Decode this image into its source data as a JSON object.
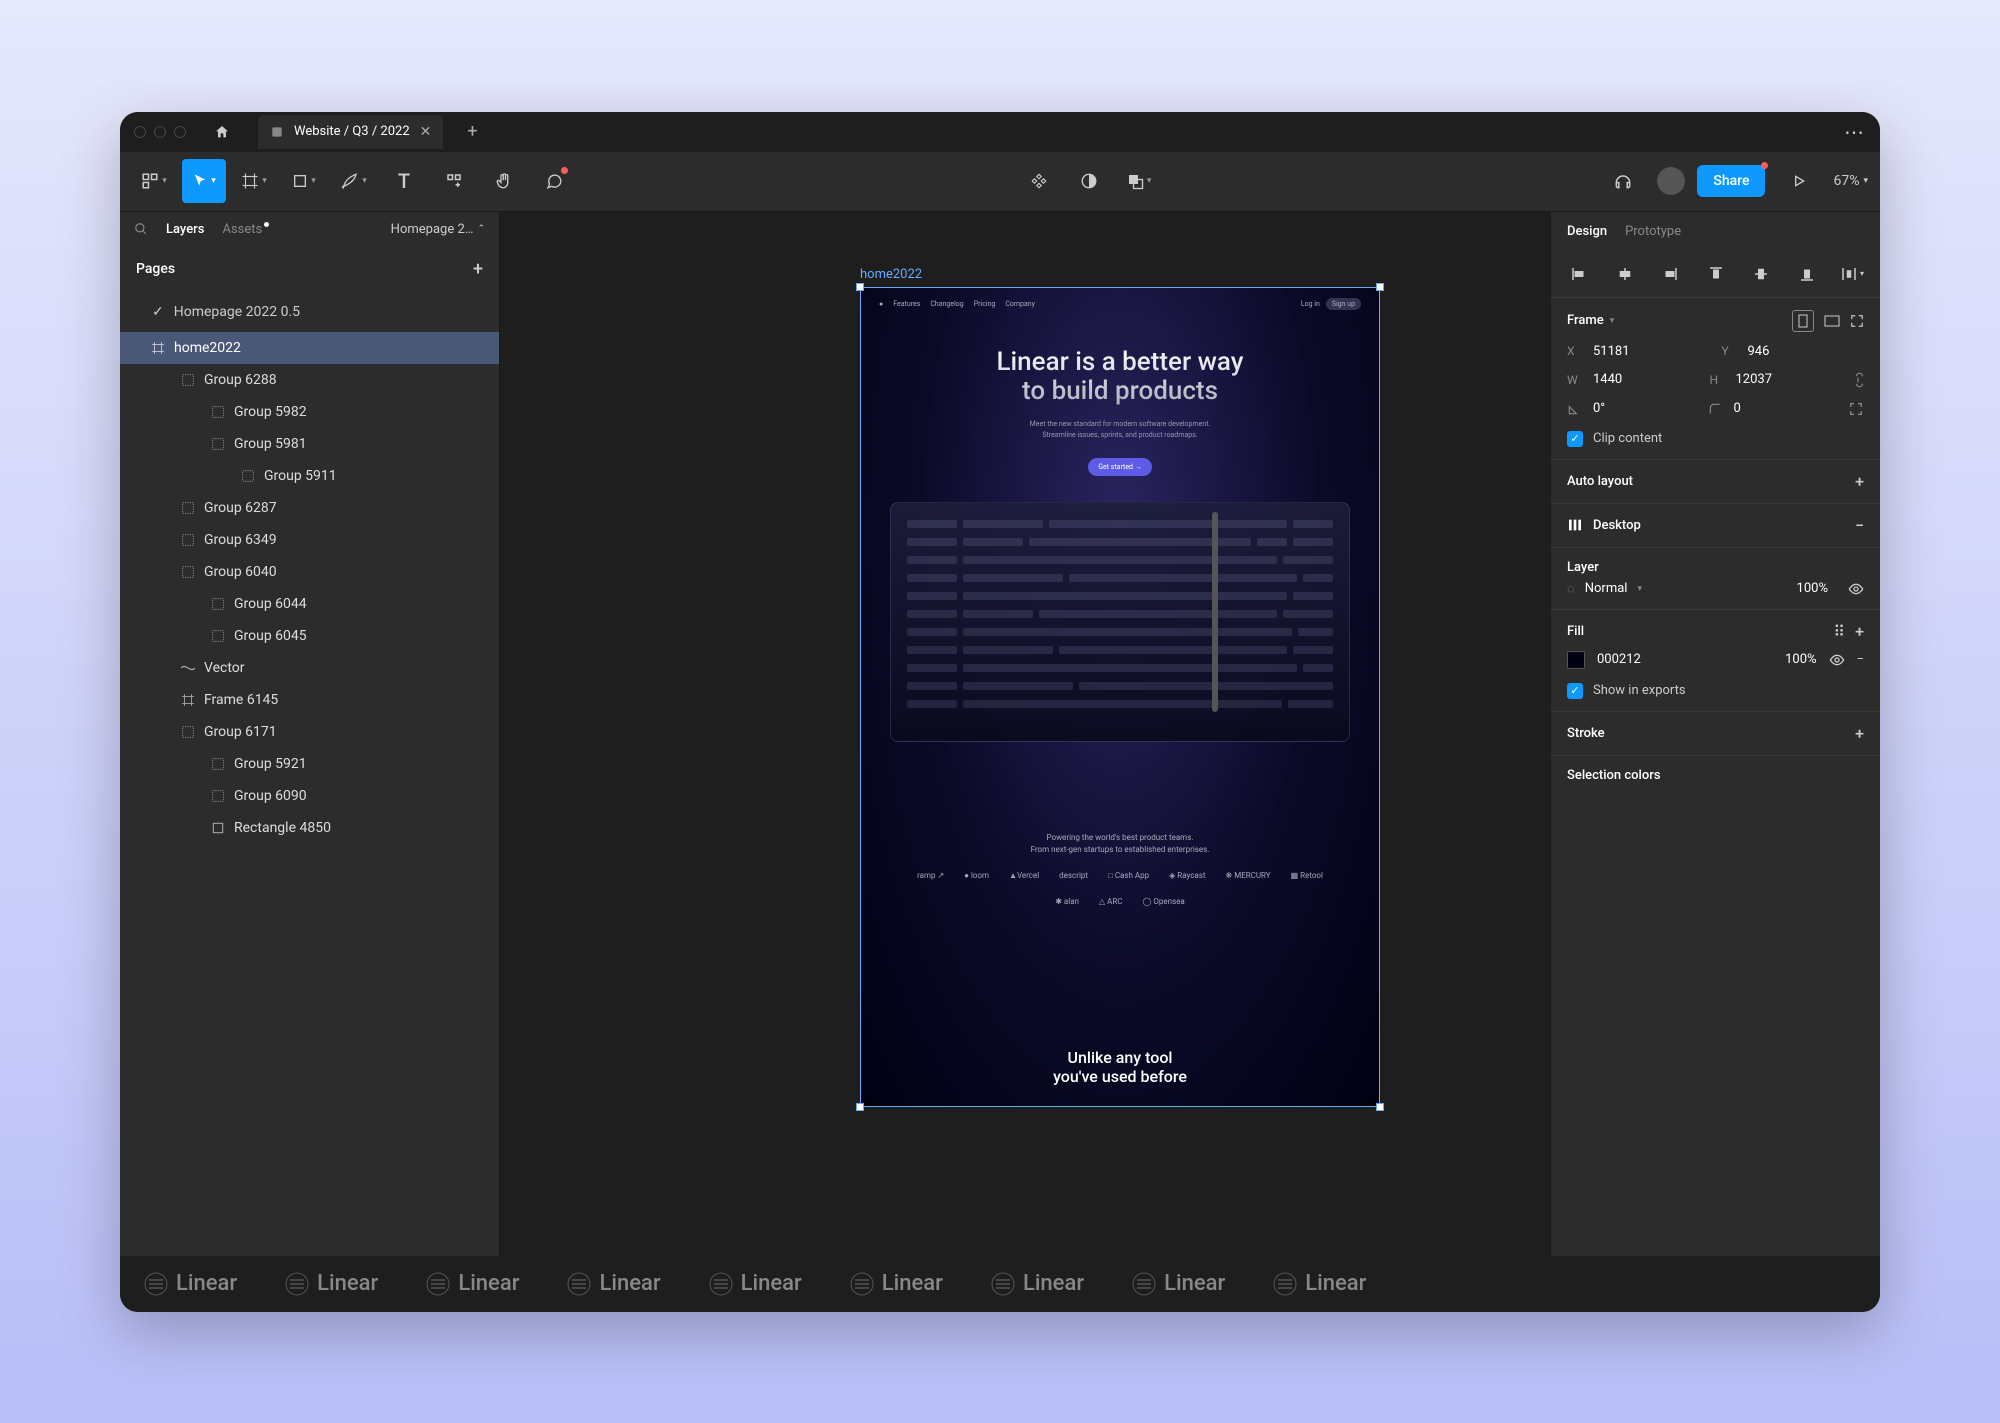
{
  "tab": {
    "title": "Website / Q3 / 2022"
  },
  "toolbar": {
    "share": "Share",
    "zoom": "67%"
  },
  "leftPanel": {
    "tabs": {
      "layers": "Layers",
      "assets": "Assets"
    },
    "breadcrumb": "Homepage 2…",
    "pagesLabel": "Pages",
    "pages": [
      {
        "name": "Homepage 2022 0.5",
        "checked": true
      },
      {
        "name": "home2022"
      }
    ],
    "layers": [
      {
        "name": "home2022",
        "indent": 1,
        "selected": true,
        "icon": "frame"
      },
      {
        "name": "Group 6288",
        "indent": 2,
        "icon": "group"
      },
      {
        "name": "Group 5982",
        "indent": 3,
        "icon": "group"
      },
      {
        "name": "Group 5981",
        "indent": 3,
        "icon": "group"
      },
      {
        "name": "Group 5911",
        "indent": 3,
        "icon": "group",
        "extraIndent": true
      },
      {
        "name": "Group 6287",
        "indent": 2,
        "icon": "group"
      },
      {
        "name": "Group 6349",
        "indent": 2,
        "icon": "group"
      },
      {
        "name": "Group 6040",
        "indent": 2,
        "icon": "group"
      },
      {
        "name": "Group 6044",
        "indent": 3,
        "icon": "group"
      },
      {
        "name": "Group 6045",
        "indent": 3,
        "icon": "group"
      },
      {
        "name": "Vector",
        "indent": 2,
        "icon": "vector"
      },
      {
        "name": "Frame 6145",
        "indent": 2,
        "icon": "frame"
      },
      {
        "name": "Group 6171",
        "indent": 2,
        "icon": "group"
      },
      {
        "name": "Group 5921",
        "indent": 3,
        "icon": "group"
      },
      {
        "name": "Group 6090",
        "indent": 3,
        "icon": "group"
      },
      {
        "name": "Rectangle 4850",
        "indent": 3,
        "icon": "rect"
      }
    ]
  },
  "canvas": {
    "frameLabel": "home2022",
    "nav": {
      "items": [
        "Features",
        "Changelog",
        "Pricing",
        "Company"
      ],
      "login": "Log in",
      "signup": "Sign up"
    },
    "hero": {
      "line1": "Linear is a better way",
      "line2": "to build products",
      "sub1": "Meet the new standard for modern software development.",
      "sub2": "Streamline issues, sprints, and product roadmaps.",
      "cta": "Get started →"
    },
    "trust": {
      "line1": "Powering the world's best product teams.",
      "line2": "From next-gen startups to established enterprises.",
      "logos": [
        "ramp ↗",
        "● loom",
        "▲Vercel",
        "descript",
        "□ Cash App",
        "◈ Raycast",
        "❋ MERCURY",
        "▦ Retool",
        "✱ alan",
        "△ ARC",
        "◯ Opensea"
      ]
    },
    "section2": {
      "line1": "Unlike any tool",
      "line2": "you've used before"
    }
  },
  "rightPanel": {
    "tabs": {
      "design": "Design",
      "prototype": "Prototype"
    },
    "frame": {
      "label": "Frame",
      "x": "51181",
      "y": "946",
      "w": "1440",
      "h": "12037",
      "rotation": "0°",
      "radius": "0",
      "clip": "Clip content"
    },
    "autoLayout": "Auto layout",
    "breakpoint": "Desktop",
    "layer": {
      "label": "Layer",
      "blend": "Normal",
      "opacity": "100%"
    },
    "fill": {
      "label": "Fill",
      "hex": "000212",
      "opacity": "100%",
      "show": "Show in exports"
    },
    "stroke": "Stroke",
    "selColors": "Selection colors"
  },
  "footer": {
    "brand": "Linear"
  }
}
